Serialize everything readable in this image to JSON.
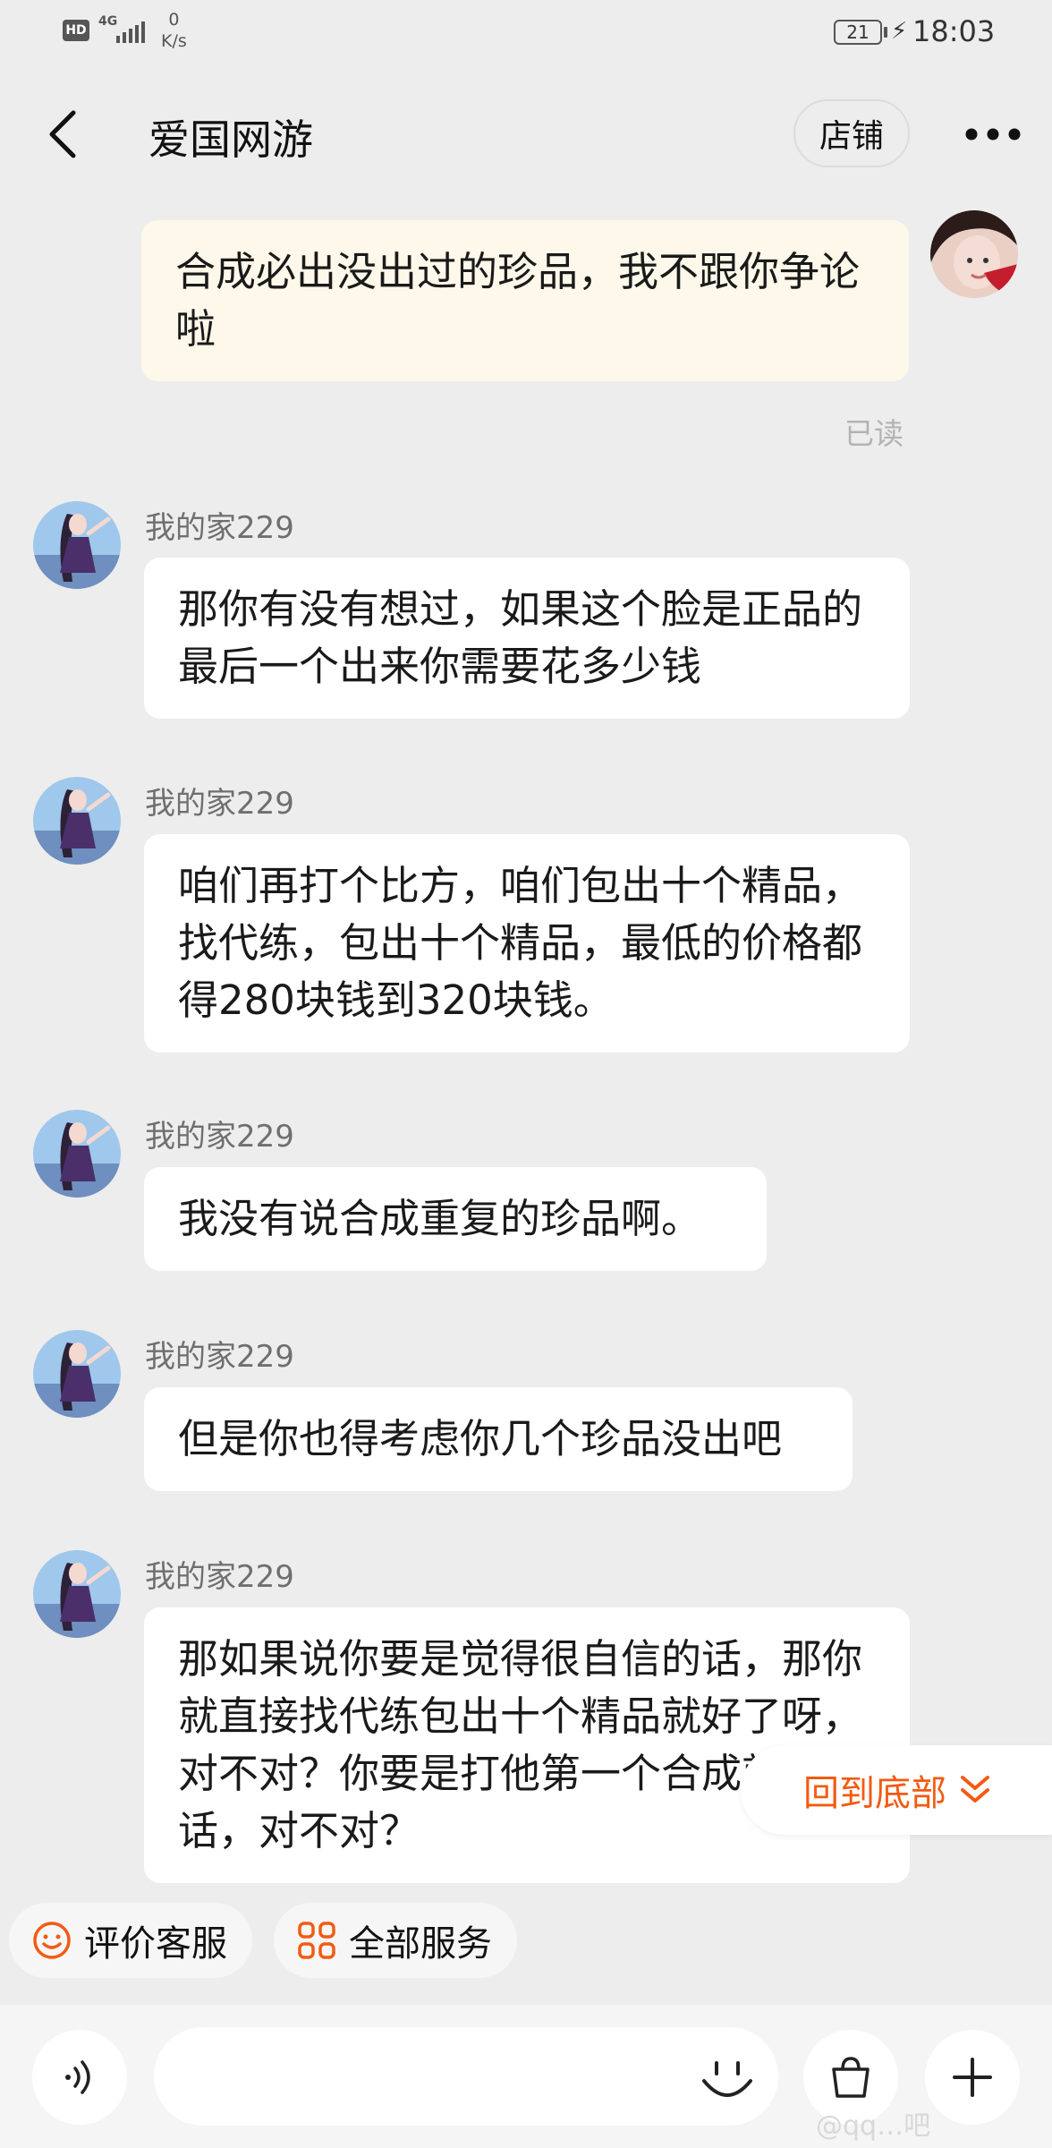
{
  "status_bar": {
    "hd": "HD",
    "network": "4G",
    "speed_value": "0",
    "speed_unit": "K/s",
    "battery": "21",
    "time": "18:03"
  },
  "header": {
    "title": "爱国网游",
    "shop_label": "店铺"
  },
  "messages": [
    {
      "from": "me",
      "text": "合成必出没出过的珍品，我不跟你争论啦",
      "read_status": "已读"
    },
    {
      "from": "other",
      "sender": "我的家229",
      "text": "那你有没有想过，如果这个脸是正品的最后一个出来你需要花多少钱"
    },
    {
      "from": "other",
      "sender": "我的家229",
      "text": "咱们再打个比方，咱们包出十个精品，找代练，包出十个精品，最低的价格都得280块钱到320块钱。"
    },
    {
      "from": "other",
      "sender": "我的家229",
      "text": "我没有说合成重复的珍品啊。"
    },
    {
      "from": "other",
      "sender": "我的家229",
      "text": "但是你也得考虑你几个珍品没出吧"
    },
    {
      "from": "other",
      "sender": "我的家229",
      "text": "那如果说你要是觉得很自信的话，那你就直接找代练包出十个精品就好了呀，对不对？你要是打他第一个合成就出的话，对不对？"
    }
  ],
  "floating": {
    "back_to_bottom": "回到底部"
  },
  "quick_actions": [
    {
      "label": "评价客服",
      "icon": "smiley-icon"
    },
    {
      "label": "全部服务",
      "icon": "grid-icon"
    }
  ],
  "input": {
    "placeholder": ""
  },
  "watermark": "@qq…吧",
  "colors": {
    "accent": "#f25b12",
    "my_bubble": "#fdf8ea",
    "background": "#ededed"
  }
}
